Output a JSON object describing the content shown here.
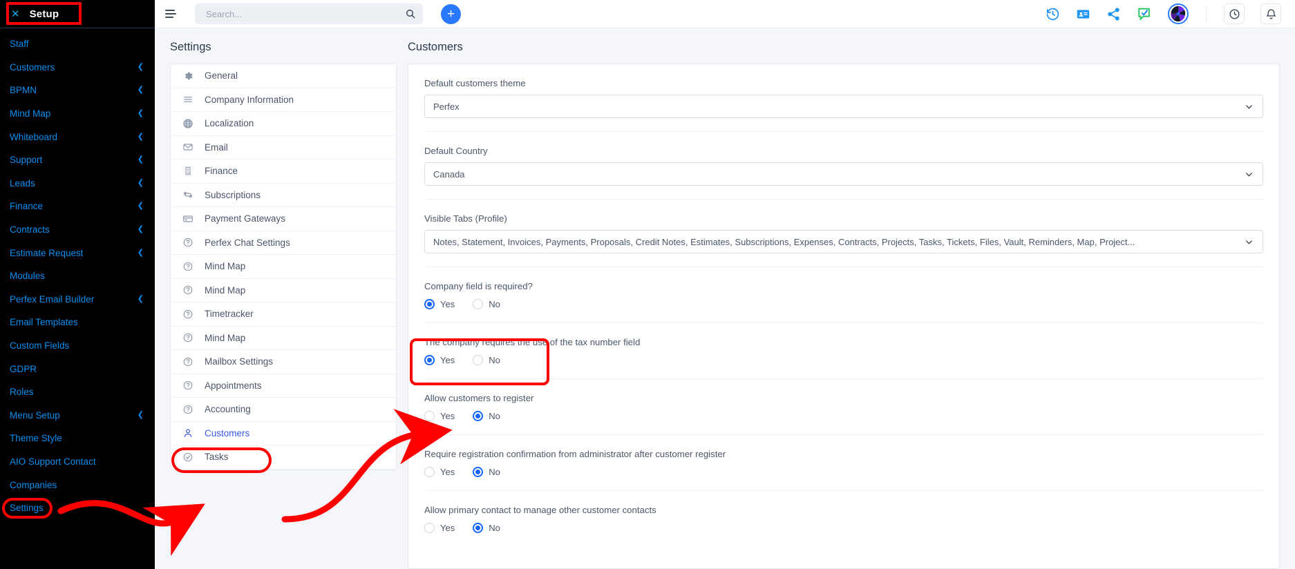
{
  "sidebar": {
    "header": {
      "title": "Setup",
      "close_icon": "close-icon"
    },
    "items": [
      {
        "label": "Staff",
        "expandable": false
      },
      {
        "label": "Customers",
        "expandable": true
      },
      {
        "label": "BPMN",
        "expandable": true
      },
      {
        "label": "Mind Map",
        "expandable": true
      },
      {
        "label": "Whiteboard",
        "expandable": true
      },
      {
        "label": "Support",
        "expandable": true
      },
      {
        "label": "Leads",
        "expandable": true
      },
      {
        "label": "Finance",
        "expandable": true
      },
      {
        "label": "Contracts",
        "expandable": true
      },
      {
        "label": "Estimate Request",
        "expandable": true
      },
      {
        "label": "Modules",
        "expandable": false
      },
      {
        "label": "Perfex Email Builder",
        "expandable": true
      },
      {
        "label": "Email Templates",
        "expandable": false
      },
      {
        "label": "Custom Fields",
        "expandable": false
      },
      {
        "label": "GDPR",
        "expandable": false
      },
      {
        "label": "Roles",
        "expandable": false
      },
      {
        "label": "Menu Setup",
        "expandable": true
      },
      {
        "label": "Theme Style",
        "expandable": false
      },
      {
        "label": "AIO Support Contact",
        "expandable": false
      },
      {
        "label": "Companies",
        "expandable": false
      },
      {
        "label": "Settings",
        "expandable": false
      }
    ]
  },
  "topbar": {
    "menu_icon": "hamburger-icon",
    "search": {
      "placeholder": "Search...",
      "value": "",
      "icon": "search-icon"
    },
    "add_button_label": "+",
    "icons": [
      "history-icon",
      "contact-card-icon",
      "share-icon",
      "chat-check-icon",
      "brand-avatar-icon",
      "clock-icon",
      "bell-icon"
    ]
  },
  "settings_panel": {
    "title": "Settings",
    "items": [
      {
        "label": "General",
        "icon": "gear-icon",
        "active": false
      },
      {
        "label": "Company Information",
        "icon": "lines-icon",
        "active": false
      },
      {
        "label": "Localization",
        "icon": "globe-icon",
        "active": false
      },
      {
        "label": "Email",
        "icon": "envelope-icon",
        "active": false
      },
      {
        "label": "Finance",
        "icon": "receipt-icon",
        "active": false
      },
      {
        "label": "Subscriptions",
        "icon": "refresh-icon",
        "active": false
      },
      {
        "label": "Payment Gateways",
        "icon": "credit-card-icon",
        "active": false
      },
      {
        "label": "Perfex Chat Settings",
        "icon": "question-circle-icon",
        "active": false
      },
      {
        "label": "Mind Map",
        "icon": "question-circle-icon",
        "active": false
      },
      {
        "label": "Mind Map",
        "icon": "question-circle-icon",
        "active": false
      },
      {
        "label": "Timetracker",
        "icon": "question-circle-icon",
        "active": false
      },
      {
        "label": "Mind Map",
        "icon": "question-circle-icon",
        "active": false
      },
      {
        "label": "Mailbox Settings",
        "icon": "question-circle-icon",
        "active": false
      },
      {
        "label": "Appointments",
        "icon": "question-circle-icon",
        "active": false
      },
      {
        "label": "Accounting",
        "icon": "question-circle-icon",
        "active": false
      },
      {
        "label": "Customers",
        "icon": "user-icon",
        "active": true
      },
      {
        "label": "Tasks",
        "icon": "check-circle-icon",
        "active": false
      }
    ]
  },
  "detail_panel": {
    "title": "Customers",
    "fields": [
      {
        "type": "select",
        "label": "Default customers theme",
        "value": "Perfex"
      },
      {
        "type": "select",
        "label": "Default Country",
        "value": "Canada"
      },
      {
        "type": "select",
        "label": "Visible Tabs (Profile)",
        "value": "Notes, Statement, Invoices, Payments, Proposals, Credit Notes, Estimates, Subscriptions, Expenses, Contracts, Projects, Tasks, Tickets, Files, Vault, Reminders, Map, Project..."
      },
      {
        "type": "radio",
        "label": "Company field is required?",
        "options": [
          "Yes",
          "No"
        ],
        "selected": "Yes"
      },
      {
        "type": "radio",
        "label": "The company requires the use of the tax number field",
        "options": [
          "Yes",
          "No"
        ],
        "selected": "Yes"
      },
      {
        "type": "radio",
        "label": "Allow customers to register",
        "options": [
          "Yes",
          "No"
        ],
        "selected": "No",
        "highlighted": true
      },
      {
        "type": "radio",
        "label": "Require registration confirmation from administrator after customer register",
        "options": [
          "Yes",
          "No"
        ],
        "selected": "No"
      },
      {
        "type": "radio",
        "label": "Allow primary contact to manage other customer contacts",
        "options": [
          "Yes",
          "No"
        ],
        "selected": "No"
      }
    ]
  },
  "annotations": {
    "color": "#ff0000",
    "highlight_setup_header": "Setup",
    "highlight_sidebar_item": "Settings",
    "highlight_settings_item": "Customers",
    "highlight_field": "Allow customers to register"
  }
}
